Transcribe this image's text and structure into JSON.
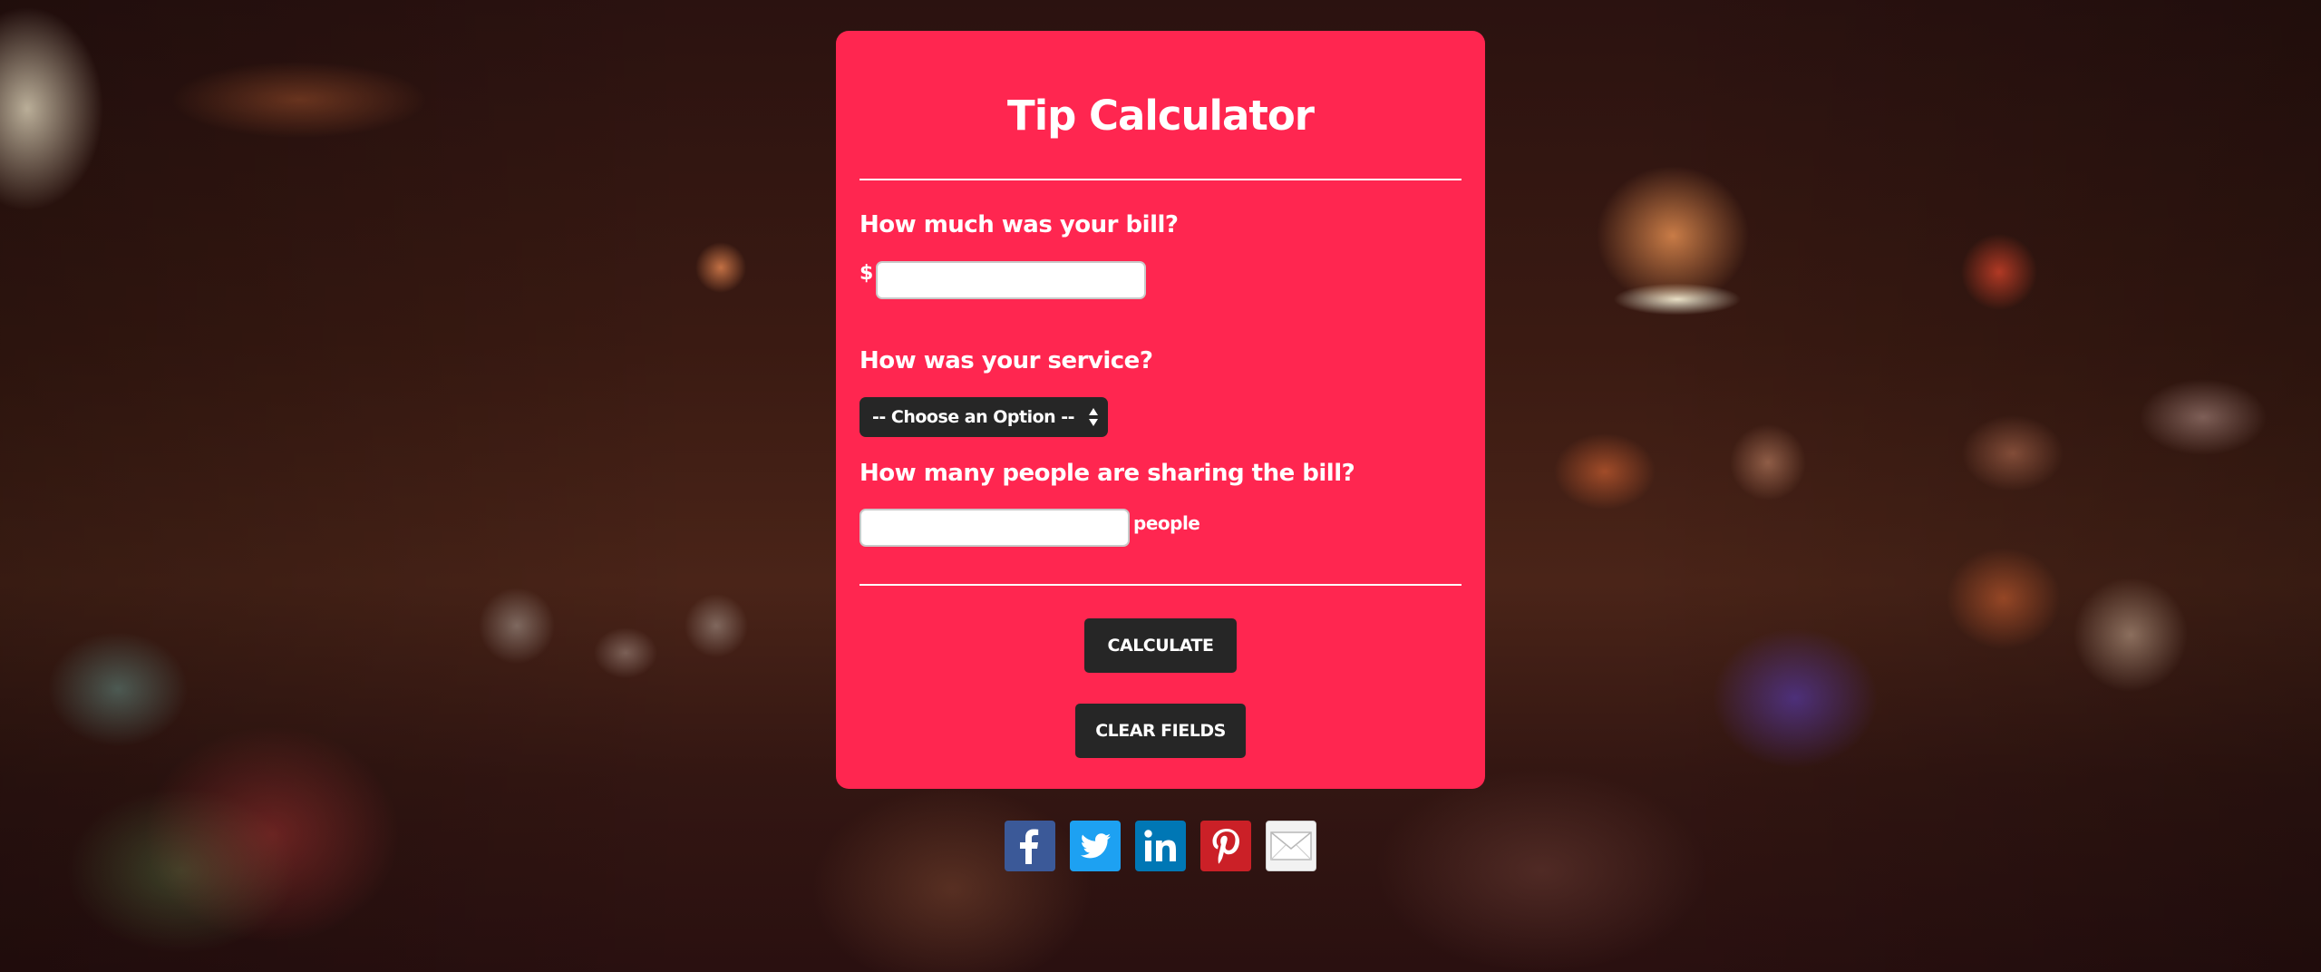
{
  "app": {
    "title": "Tip Calculator"
  },
  "form": {
    "bill_question": "How much was your bill?",
    "currency_symbol": "$",
    "bill_value": "",
    "service_question": "How was your service?",
    "service_selected": "-- Choose an Option --",
    "people_question": "How many people are sharing the bill?",
    "people_value": "",
    "people_suffix": "people"
  },
  "buttons": {
    "calculate_label": "CALCULATE",
    "clear_label": "CLEAR FIELDS"
  },
  "share": {
    "icons": [
      "facebook-icon",
      "twitter-icon",
      "linkedin-icon",
      "pinterest-icon",
      "email-icon"
    ]
  },
  "colors": {
    "card_background": "#ff2650",
    "button_background": "#262626",
    "facebook": "#3b5998",
    "twitter": "#1da1f2",
    "linkedin": "#0077b5",
    "pinterest": "#cb2027",
    "email": "#f2f2f2"
  }
}
